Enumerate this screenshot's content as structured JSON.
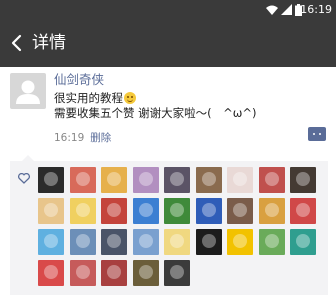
{
  "status_bar": {
    "time": "16:19"
  },
  "header": {
    "title": "详情"
  },
  "post": {
    "author": "仙剑奇侠",
    "line1": "很实用的教程",
    "line2": "需要收集五个赞 谢谢大家啦～(　^ω^)",
    "time": "16:19",
    "delete_label": "删除"
  },
  "likes": {
    "avatars": [
      {
        "color": "#2b2b2b"
      },
      {
        "color": "#d86a5a"
      },
      {
        "color": "#e6b04c"
      },
      {
        "color": "#b28fc0"
      },
      {
        "color": "#5b5366"
      },
      {
        "color": "#8a6b4e"
      },
      {
        "color": "#e9d9d6"
      },
      {
        "color": "#c0504d"
      },
      {
        "color": "#443a33"
      },
      {
        "color": "#e8c58b"
      },
      {
        "color": "#f0d060"
      },
      {
        "color": "#c4443c"
      },
      {
        "color": "#3c7fd2"
      },
      {
        "color": "#3f8a3a"
      },
      {
        "color": "#2f5db8"
      },
      {
        "color": "#7a5c4a"
      },
      {
        "color": "#d9a040"
      },
      {
        "color": "#d04848"
      },
      {
        "color": "#5fb0e0"
      },
      {
        "color": "#6c8fb8"
      },
      {
        "color": "#4a5468"
      },
      {
        "color": "#7aa0cf"
      },
      {
        "color": "#f0d880"
      },
      {
        "color": "#1c1c1c"
      },
      {
        "color": "#f2c200"
      },
      {
        "color": "#6aab5a"
      },
      {
        "color": "#2f9e8f"
      },
      {
        "color": "#d94a4a"
      },
      {
        "color": "#c65b5b"
      },
      {
        "color": "#a84040"
      },
      {
        "color": "#6b5e3a"
      },
      {
        "color": "#3b3b3b"
      }
    ]
  }
}
